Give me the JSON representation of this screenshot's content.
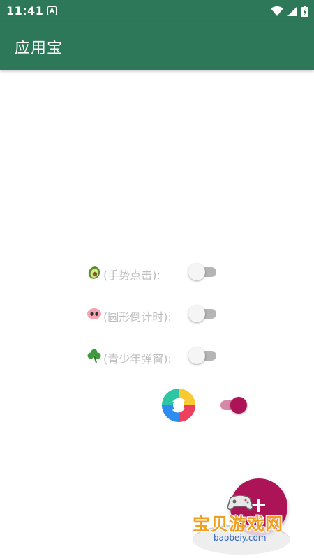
{
  "status_bar": {
    "time": "11:41",
    "badge": "A",
    "icons": [
      "wifi-icon",
      "signal-icon",
      "battery-icon"
    ]
  },
  "app_bar": {
    "title": "应用宝"
  },
  "settings": [
    {
      "id": "gesture-tap",
      "emoji": "avocado-icon",
      "label": "(手势点击):",
      "enabled": false
    },
    {
      "id": "circle-countdown",
      "emoji": "pig-nose-icon",
      "label": "(圆形倒计时):",
      "enabled": false
    },
    {
      "id": "teen-popup",
      "emoji": "shamrock-icon",
      "label": "(青少年弹窗):",
      "enabled": false
    }
  ],
  "app_toggle": {
    "logo": "app-store-logo",
    "enabled": true
  },
  "fab": {
    "icon": "plus-icon",
    "symbol": "+"
  },
  "watermark": {
    "text": "宝贝游戏网",
    "url": "baobeiy.com"
  },
  "colors": {
    "primary": "#2c7859",
    "accent": "#ad1457",
    "accent_light": "#d788a7",
    "label_gray": "#bdbdbd"
  }
}
